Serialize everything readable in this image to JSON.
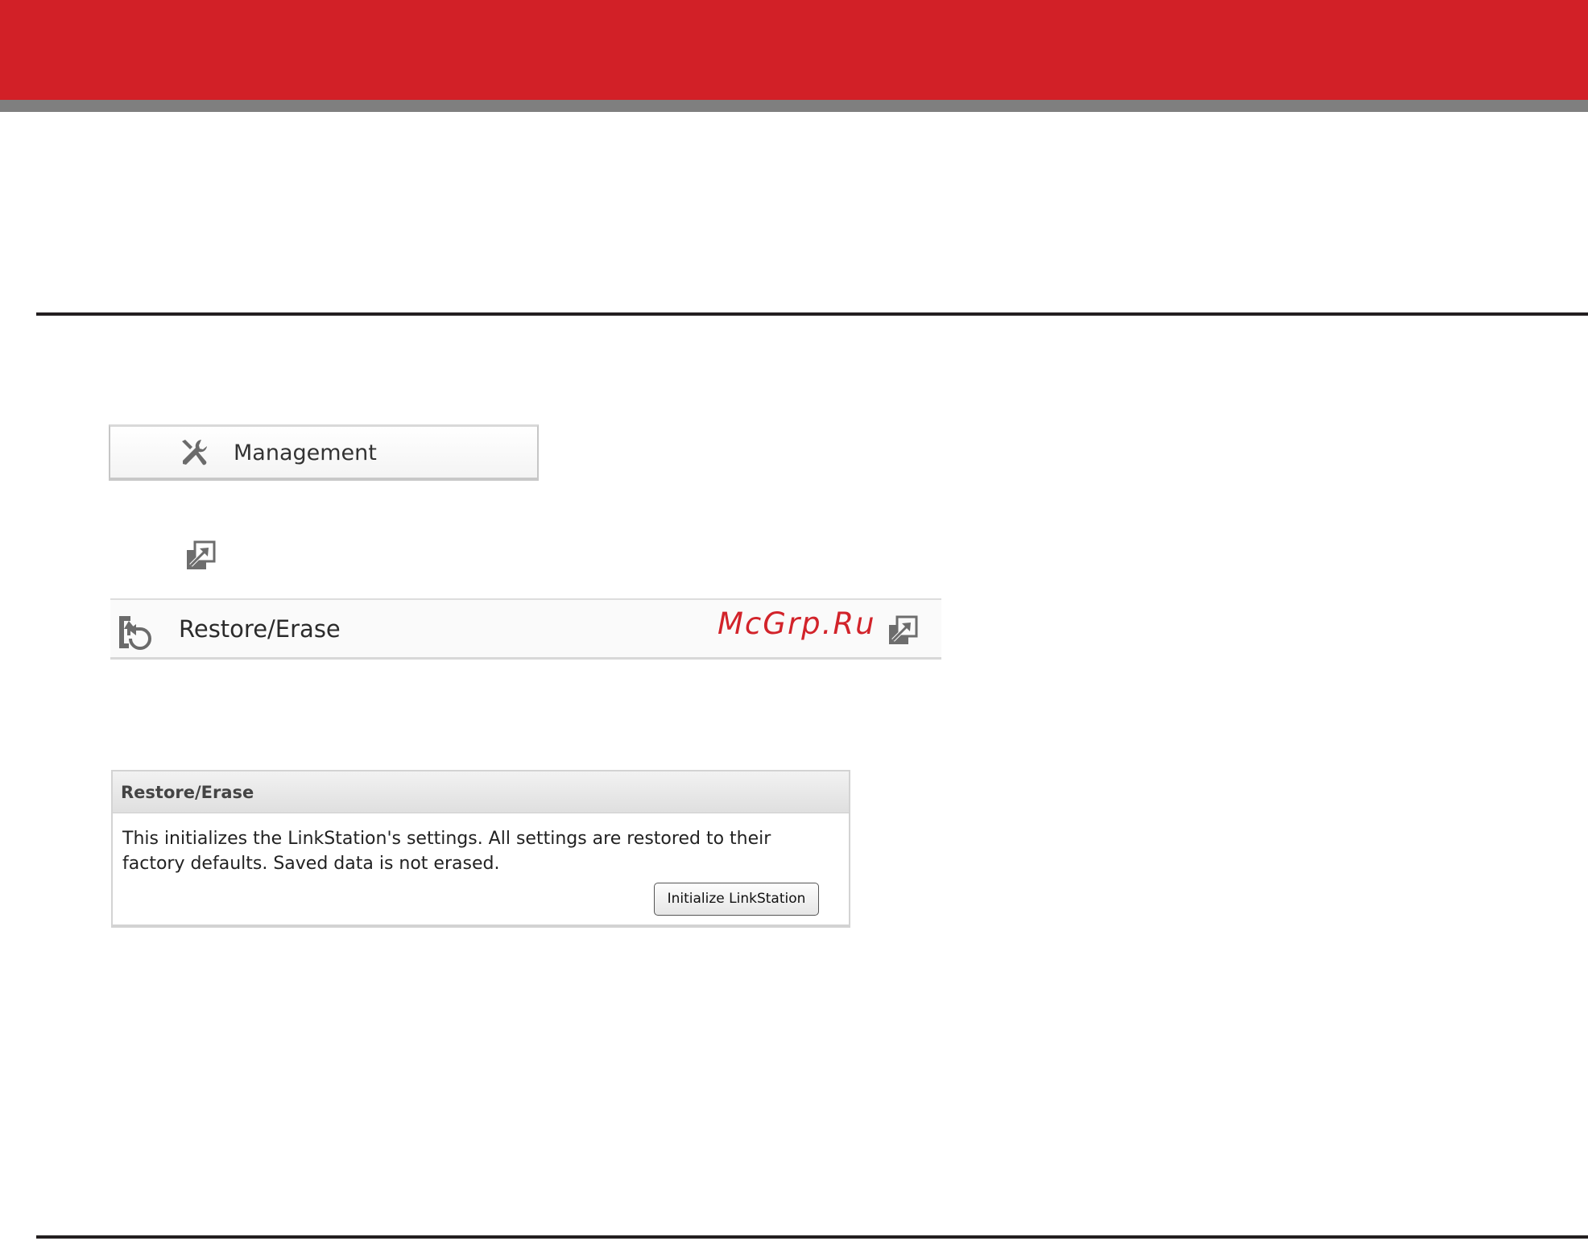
{
  "menu": {
    "management": {
      "label": "Management",
      "icon": "tools-icon"
    },
    "restore_erase": {
      "label": "Restore/Erase",
      "icon": "restore-icon",
      "action_icon": "expand-icon"
    }
  },
  "standalone_icon": "expand-icon",
  "watermark": "McGrp.Ru",
  "panel": {
    "title": "Restore/Erase",
    "description": "This initializes the LinkStation's settings. All settings are restored to their factory defaults. Saved data is not erased.",
    "button_label": "Initialize LinkStation"
  },
  "colors": {
    "banner": "#d22027",
    "banner_shadow": "#7f7f7f",
    "watermark": "#d2232a",
    "icon_gray": "#6d6d6d"
  }
}
